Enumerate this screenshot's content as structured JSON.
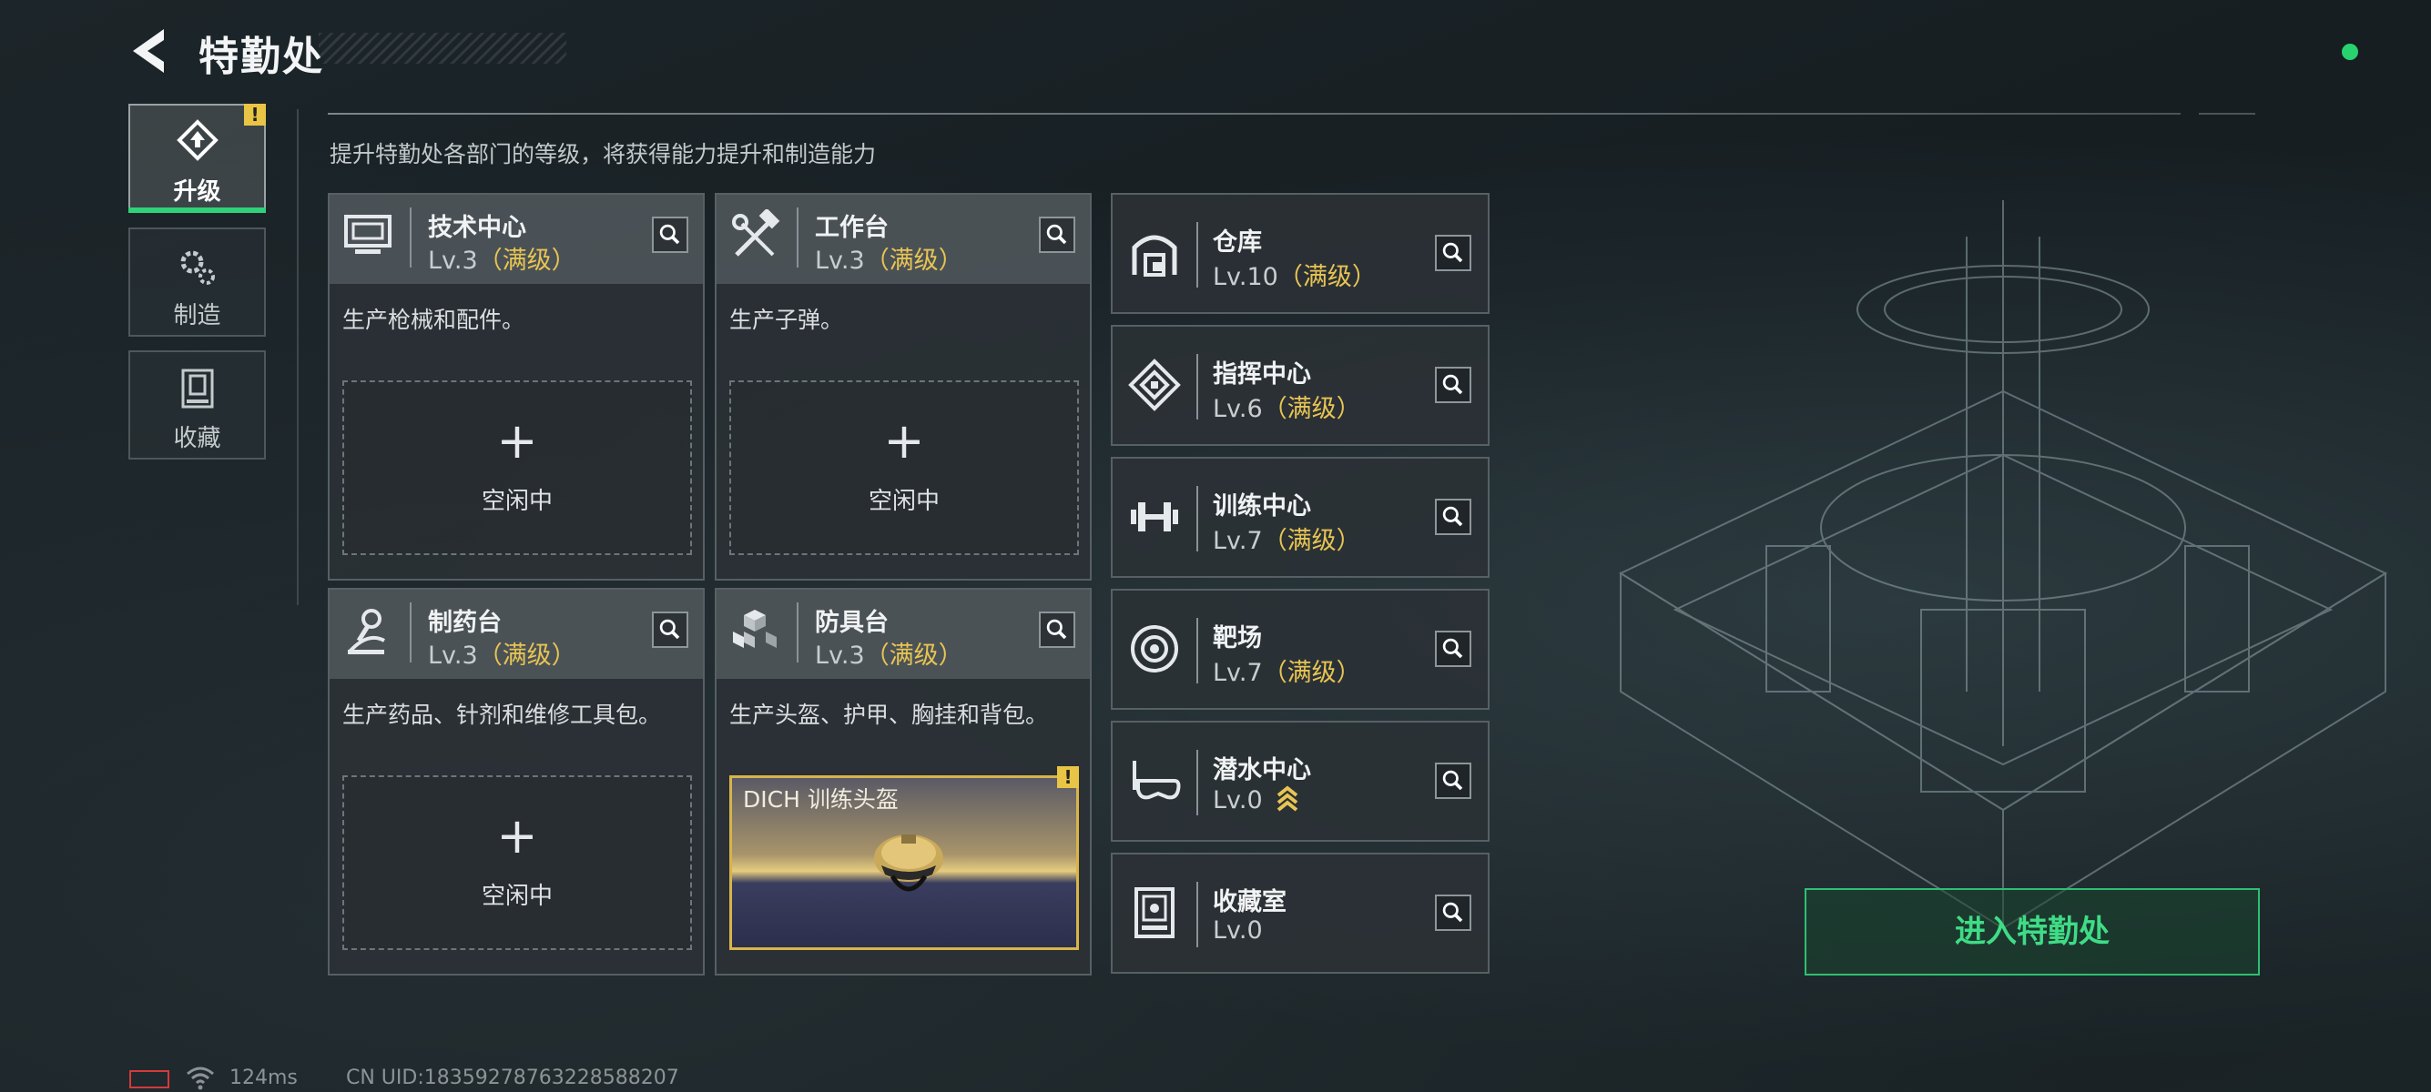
{
  "header": {
    "title": "特勤处"
  },
  "nav": [
    {
      "label": "升级",
      "icon": "upgrade-icon",
      "active": true,
      "alert": "!"
    },
    {
      "label": "制造",
      "icon": "gears-icon",
      "active": false
    },
    {
      "label": "收藏",
      "icon": "collection-icon",
      "active": false
    }
  ],
  "subtitle": "提升特勤处各部门的等级，将获得能力提升和制造能力",
  "departments": [
    {
      "name": "技术中心",
      "level": "Lv.3",
      "max": "（满级）",
      "desc": "生产枪械和配件。",
      "slot": {
        "plus": "+",
        "status": "空闲中"
      }
    },
    {
      "name": "工作台",
      "level": "Lv.3",
      "max": "（满级）",
      "desc": "生产子弹。",
      "slot": {
        "plus": "+",
        "status": "空闲中"
      }
    },
    {
      "name": "制药台",
      "level": "Lv.3",
      "max": "（满级）",
      "desc": "生产药品、针剂和维修工具包。",
      "slot": {
        "plus": "+",
        "status": "空闲中"
      }
    },
    {
      "name": "防具台",
      "level": "Lv.3",
      "max": "（满级）",
      "desc": "生产头盔、护甲、胸挂和背包。",
      "slot": {
        "item": "DICH 训练头盔",
        "alert": "!"
      }
    }
  ],
  "facilities": [
    {
      "name": "仓库",
      "level": "Lv.10",
      "max": "（满级）",
      "icon": "warehouse-icon"
    },
    {
      "name": "指挥中心",
      "level": "Lv.6",
      "max": "（满级）",
      "icon": "command-center-icon"
    },
    {
      "name": "训练中心",
      "level": "Lv.7",
      "max": "（满级）",
      "icon": "dumbbell-icon"
    },
    {
      "name": "靶场",
      "level": "Lv.7",
      "max": "（满级）",
      "icon": "target-icon"
    },
    {
      "name": "潜水中心",
      "level": "Lv.0",
      "max": "",
      "icon": "diving-mask-icon",
      "upgradable": true
    },
    {
      "name": "收藏室",
      "level": "Lv.0",
      "max": "",
      "icon": "collection-room-icon"
    }
  ],
  "enter_button": "进入特勤处",
  "footer": {
    "ping": "124ms",
    "uid": "CN UID:18359278763228588207"
  },
  "colors": {
    "accent_green": "#2fd27a",
    "gold": "#e8c453",
    "warning": "#e9c545"
  }
}
